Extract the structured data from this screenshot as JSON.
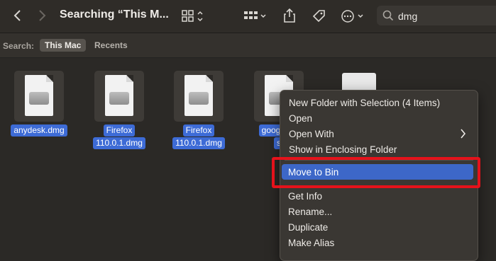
{
  "toolbar": {
    "title": "Searching “This M...",
    "search_value": "dmg",
    "icons": [
      "back-icon",
      "forward-icon",
      "grid-view-icon",
      "group-icon",
      "share-icon",
      "tag-icon",
      "more-icon",
      "search-icon"
    ]
  },
  "scope": {
    "label": "Search:",
    "this_mac": "This Mac",
    "recents": "Recents"
  },
  "files": [
    {
      "name_line1": "anydesk.dmg",
      "name_line2": ""
    },
    {
      "name_line1": "Firefox",
      "name_line2": "110.0.1.dmg"
    },
    {
      "name_line1": "Firefox",
      "name_line2": "110.0.1.dmg"
    },
    {
      "name_line1": "googlech",
      "name_line2": "s"
    }
  ],
  "context_menu": {
    "items": [
      "New Folder with Selection (4 Items)",
      "Open",
      "Open With",
      "Show in Enclosing Folder",
      "Move to Bin",
      "Get Info",
      "Rename...",
      "Duplicate",
      "Make Alias"
    ],
    "highlighted": "Move to Bin"
  },
  "colors": {
    "highlight": "#3d67c8",
    "annotation_red": "#e5121b",
    "selection": "#3d6bd6"
  }
}
